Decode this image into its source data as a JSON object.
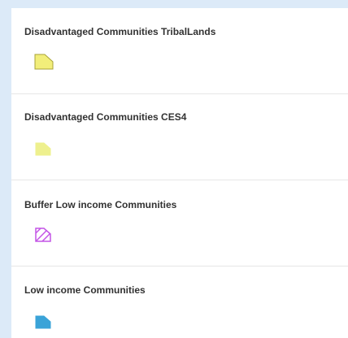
{
  "legend": {
    "items": [
      {
        "label": "Disadvantaged Communities TribalLands",
        "swatch": "yellow-outlined-polygon-icon",
        "fill": "#f2ee7a",
        "stroke": "#a8a338"
      },
      {
        "label": "Disadvantaged Communities CES4",
        "swatch": "pale-yellow-polygon-icon",
        "fill": "#eef08e",
        "stroke": "#eef08e"
      },
      {
        "label": "Buffer Low income Communities",
        "swatch": "purple-hatched-polygon-icon",
        "fill": "#ffffff",
        "stroke": "#c455e6"
      },
      {
        "label": "Low income Communities",
        "swatch": "blue-polygon-icon",
        "fill": "#3aa3d8",
        "stroke": "#3aa3d8"
      }
    ]
  }
}
